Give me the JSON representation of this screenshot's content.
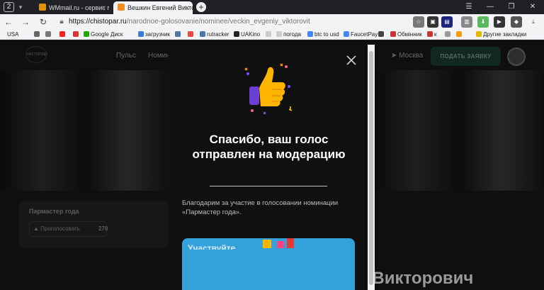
{
  "browser": {
    "tab_count": "2",
    "tabs": [
      {
        "title": "WMmail.ru - сервис почт",
        "favicon_color": "#e39200"
      },
      {
        "title": "Вешкин Евгений Виктор",
        "favicon_color": "#f18e2a"
      }
    ],
    "url_host": "https://chistopar.ru",
    "url_path": "/narodnoe-golosovanie/nominee/veckin_evgeniy_viktorovit",
    "bookmarks": [
      {
        "label": "USA",
        "color": ""
      },
      {
        "label": "",
        "color": "#666"
      },
      {
        "label": "",
        "color": "#777"
      },
      {
        "label": "",
        "color": "#e22"
      },
      {
        "label": "",
        "color": "#d33"
      },
      {
        "label": "Google Диск",
        "color": "#1faa00"
      },
      {
        "label": "загрузчик",
        "color": "#3a7bd5"
      },
      {
        "label": "",
        "color": "#4a76a8"
      },
      {
        "label": "",
        "color": "#e44"
      },
      {
        "label": "rutracker",
        "color": "#4a76a8"
      },
      {
        "label": "UAKino",
        "color": "#222"
      },
      {
        "label": "",
        "color": "#ccc"
      },
      {
        "label": "погода",
        "color": "#ccc"
      },
      {
        "label": "btc to usd",
        "color": "#4285f4"
      },
      {
        "label": "FaucetPay",
        "color": "#4285f4"
      },
      {
        "label": "",
        "color": "#444"
      },
      {
        "label": "Обмінник",
        "color": "#c33"
      },
      {
        "label": "к",
        "color": "#c33"
      },
      {
        "label": "",
        "color": "#999"
      },
      {
        "label": "",
        "color": "#f39c12"
      },
      {
        "label": "Другие закладки",
        "color": "#e6b800"
      }
    ]
  },
  "site": {
    "logo_text": "чистопар",
    "nav": [
      "Пульс",
      "Номин"
    ],
    "city": "Москва",
    "apply_button": "ПОДАТЬ ЗАЯВКУ",
    "nomination_card": {
      "title": "Пармастер года",
      "vote_label": "Проголосовать",
      "vote_count": "270"
    },
    "nominee_name": "Вешкин Евгений Викторович"
  },
  "modal": {
    "title": "Спасибо, ваш голос отправлен на модерацию",
    "text": "Благодарим за участие в голосовании номинации «Пармастер года».",
    "promo_text": "Участвуйте"
  },
  "colors": {
    "accent_green": "#1f4a3a",
    "promo_blue": "#33a2dc",
    "modal_bg": "#101010"
  }
}
